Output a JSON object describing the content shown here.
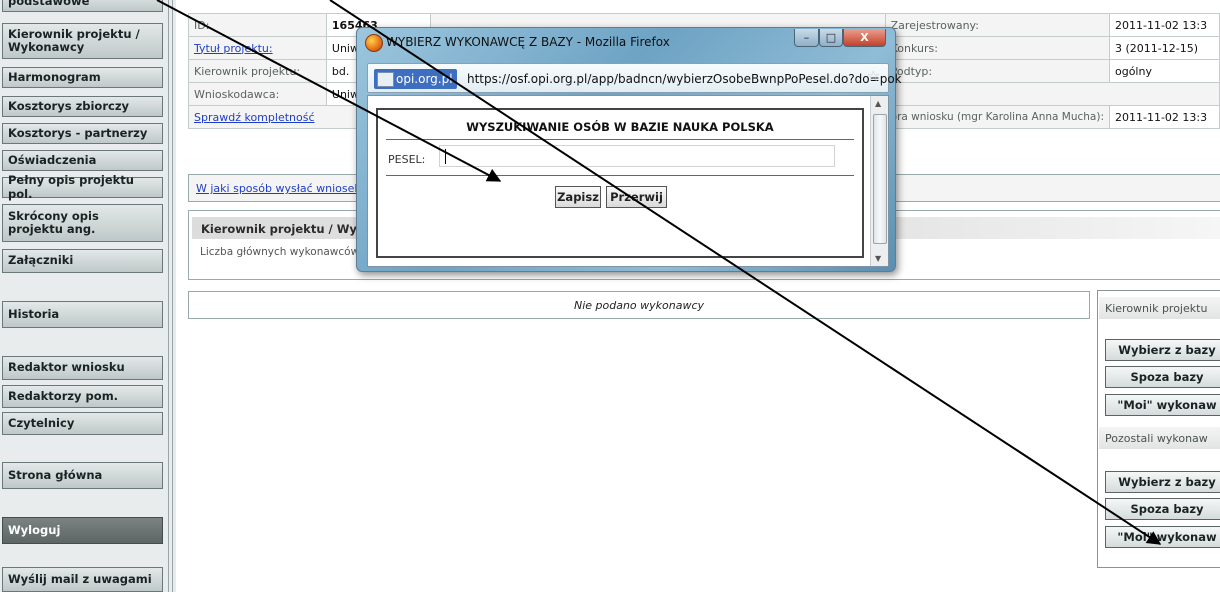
{
  "sidebar": {
    "items": [
      {
        "label": "podstawowe"
      },
      {
        "label": "Kierownik projektu / Wykonawcy"
      },
      {
        "label": "Harmonogram"
      },
      {
        "label": "Kosztorys zbiorczy"
      },
      {
        "label": "Kosztorys - partnerzy"
      },
      {
        "label": "Oświadczenia"
      },
      {
        "label": "Pełny opis projektu pol."
      },
      {
        "label": "Skrócony opis projektu ang."
      },
      {
        "label": "Załączniki"
      },
      {
        "label": "Historia"
      },
      {
        "label": "Redaktor wniosku"
      },
      {
        "label": "Redaktorzy pom."
      },
      {
        "label": "Czytelnicy"
      },
      {
        "label": "Strona główna"
      },
      {
        "label": "Wyloguj"
      },
      {
        "label": "Wyślij mail z uwagami"
      }
    ]
  },
  "info": {
    "id_label": "ID:",
    "id_value": "165463",
    "title_link": "Tytuł projektu:",
    "title_value": "Uniw",
    "manager_label": "Kierownik projektu:",
    "manager_value": "bd.",
    "applicant_label": "Wnioskodawca:",
    "applicant_value": "Uniw",
    "check_link": "Sprawdź kompletność",
    "registered_label": "Zarejestrowany:",
    "registered_value": "2011-11-02 13:3",
    "contest_label": "Konkurs:",
    "contest_value": "3 (2011-12-15)",
    "subtype_label": "Podtyp:",
    "subtype_value": "ogólny",
    "author_label": "ora wniosku (mgr Karolina Anna Mucha):",
    "author_value": "2011-11-02 13:3"
  },
  "send_link": "W jaki sposób wysłać wniosek?",
  "section": {
    "title": "Kierownik projektu / Wyko",
    "subtitle": "Liczba głównych wykonawców p",
    "empty": "Nie podano wykonawcy"
  },
  "right_panel": {
    "head1": "Kierownik projektu",
    "btn1": "Wybierz z bazy",
    "btn2": "Spoza bazy",
    "btn3": "\"Moi\" wykonaw",
    "head2": "Pozostali wykonaw",
    "btn4": "Wybierz z bazy",
    "btn5": "Spoza bazy",
    "btn6": "\"Moi\" wykonaw"
  },
  "popup": {
    "title": "WYBIERZ WYKONAWCĘ Z BAZY - Mozilla Firefox",
    "site": "opi.org.pl",
    "url": "https://osf.opi.org.pl/app/badncn/wybierzOsobeBwnpPoPesel.do?do=pok",
    "heading": "WYSZUKIWANIE OSÓB W BAZIE NAUKA POLSKA",
    "pesel_label": "PESEL:",
    "pesel_value": "",
    "save": "Zapisz",
    "cancel": "Przerwij"
  },
  "colors": {
    "accent_link": "#1f3ec7",
    "logout_bg": "#5d6565",
    "arrow": "#000000"
  }
}
